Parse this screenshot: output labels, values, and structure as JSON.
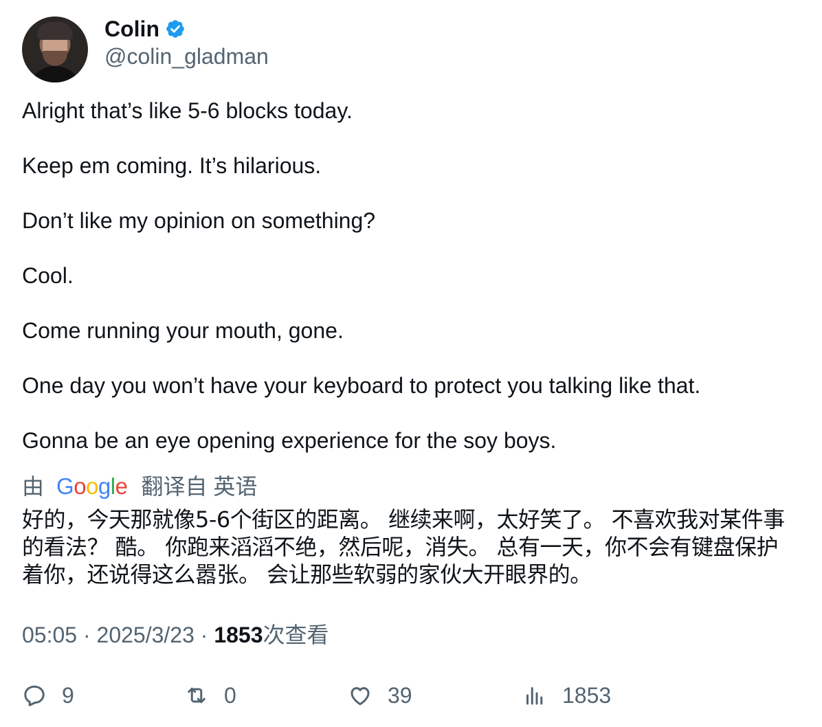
{
  "author": {
    "name": "Colin",
    "handle": "@colin_gladman",
    "verified_icon": "verified-badge-icon",
    "verified_color": "#1d9bf0"
  },
  "tweet": {
    "paragraphs": [
      "Alright that’s like 5-6 blocks today.",
      "Keep em coming. It’s hilarious.",
      "Don’t like my opinion on something?",
      "Cool.",
      "Come running your mouth, gone.",
      "One day you won’t have your keyboard to protect you talking like that.",
      "Gonna be an eye opening experience for the soy boys."
    ]
  },
  "translation": {
    "prefix": "由",
    "brand": "Google",
    "suffix": "翻译自 英语",
    "text": "好的，今天那就像5-6个街区的距离。 继续来啊，太好笑了。 不喜欢我对某件事的看法？ 酷。 你跑来滔滔不绝，然后呢，消失。 总有一天，你不会有键盘保护着你，还说得这么嚣张。 会让那些软弱的家伙大开眼界的。"
  },
  "meta": {
    "time": "05:05",
    "separator": "·",
    "date": "2025/3/23",
    "views_count": "1853",
    "views_label": "次查看"
  },
  "actions": {
    "reply": {
      "icon": "reply-icon",
      "count": "9"
    },
    "retweet": {
      "icon": "retweet-icon",
      "count": "0"
    },
    "like": {
      "icon": "heart-icon",
      "count": "39"
    },
    "views": {
      "icon": "views-chart-icon",
      "count": "1853"
    }
  }
}
